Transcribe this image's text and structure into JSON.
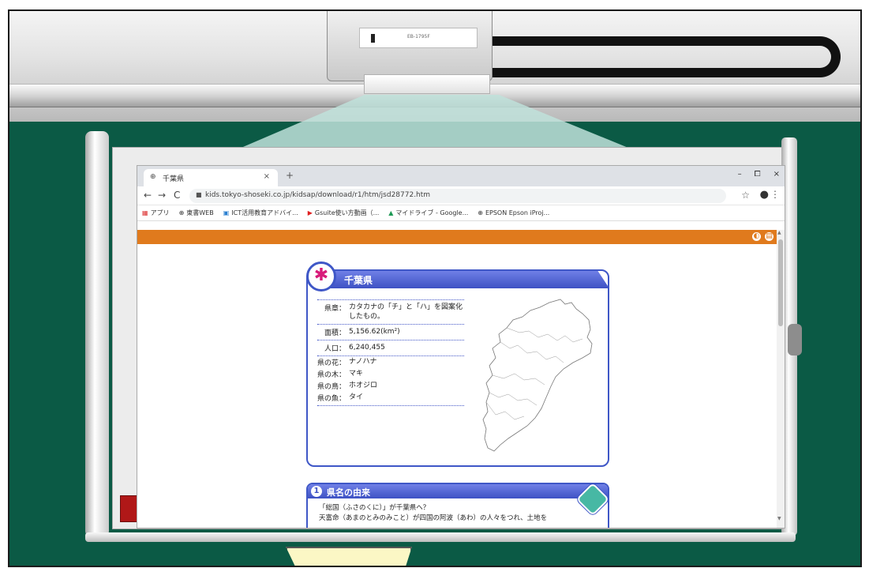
{
  "projector": {
    "model_label": "EB-1795F"
  },
  "browser": {
    "tab": {
      "favicon": "globe-icon",
      "title": "千葉県",
      "close": "×"
    },
    "new_tab": "+",
    "window_controls": [
      "–",
      "⧠",
      "×"
    ],
    "nav": {
      "back": "←",
      "forward": "→",
      "reload": "C"
    },
    "url": "kids.tokyo-shoseki.co.jp/kidsap/download/r1/htm/jsd28772.htm",
    "bookmarks": [
      {
        "icon": "apps-icon",
        "label": "アプリ"
      },
      {
        "icon": "globe-icon",
        "label": "東書WEB"
      },
      {
        "icon": "ict-icon",
        "label": "ICT活用教育アドバイ..."
      },
      {
        "icon": "youtube-icon",
        "label": "Gsuite使い方動画（..."
      },
      {
        "icon": "drive-icon",
        "label": "マイドライブ - Google..."
      },
      {
        "icon": "globe-icon",
        "label": "EPSON Epson iProj..."
      }
    ]
  },
  "card": {
    "title": "千葉県",
    "emblem": "✱",
    "rows": [
      {
        "label": "県章：",
        "value": "カタカナの「チ」と「ハ」を図案化したもの。"
      },
      {
        "label": "面積：",
        "value": "5,156.62(km²)"
      },
      {
        "label": "人口：",
        "value": "6,240,455"
      }
    ],
    "symbols": [
      {
        "label": "県の花：",
        "value": "ナノハナ"
      },
      {
        "label": "県の木：",
        "value": "マキ"
      },
      {
        "label": "県の鳥：",
        "value": "ホオジロ"
      },
      {
        "label": "県の魚：",
        "value": "タイ"
      }
    ]
  },
  "section": {
    "number": "1",
    "title": "県名の由来",
    "lines": [
      "「総国（ふさのくに）」が千葉県へ？",
      "天富命（あまのとみのみこと）が四国の阿波（あわ）の人々をつれ、土地を"
    ]
  },
  "colors": {
    "orange": "#e07a1d",
    "blue": "#3f57c7",
    "board": "#0b5a45",
    "emblem": "#d81b7a"
  }
}
